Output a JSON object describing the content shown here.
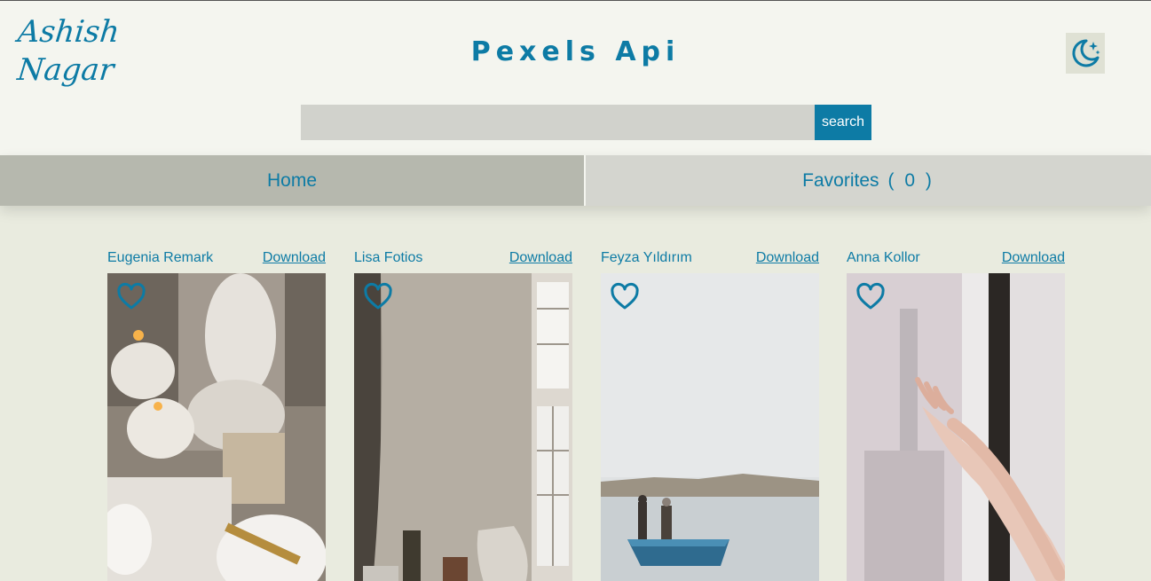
{
  "header": {
    "logo_line1": "Ashish",
    "logo_line2": "Nagar",
    "title": "Pexels Api",
    "theme_toggle_icon": "moon-stars-icon"
  },
  "search": {
    "value": "",
    "placeholder": "",
    "button_label": "search"
  },
  "nav": {
    "home_label": "Home",
    "favorites_label": "Favorites",
    "favorites_count": "( 0 )"
  },
  "colors": {
    "accent": "#0d7ba5",
    "page_bg": "#e9ebdf",
    "header_bg": "#f4f5ef",
    "active_tab": "#b6b8ae",
    "inactive_tab": "#d4d5cf"
  },
  "photos": [
    {
      "photographer": "Eugenia Remark",
      "download_label": "Download",
      "favorite_icon": "heart-outline-icon"
    },
    {
      "photographer": "Lisa Fotios",
      "download_label": "Download",
      "favorite_icon": "heart-outline-icon"
    },
    {
      "photographer": "Feyza Yıldırım",
      "download_label": "Download",
      "favorite_icon": "heart-outline-icon"
    },
    {
      "photographer": "Anna Kollor",
      "download_label": "Download",
      "favorite_icon": "heart-outline-icon"
    }
  ]
}
